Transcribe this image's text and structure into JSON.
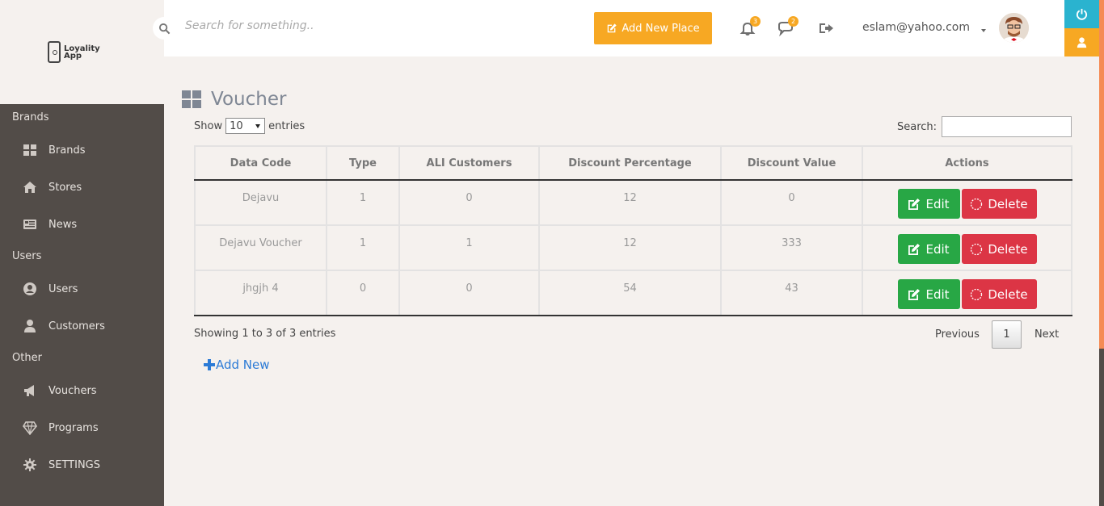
{
  "brand": {
    "logo_line1": "Loyality",
    "logo_line2": "App"
  },
  "sidebar": {
    "sections": [
      {
        "title": "Brands",
        "items": [
          {
            "label": "Brands",
            "icon": "grid-icon"
          },
          {
            "label": "Stores",
            "icon": "home-icon"
          },
          {
            "label": "News",
            "icon": "newspaper-icon"
          }
        ]
      },
      {
        "title": "Users",
        "items": [
          {
            "label": "Users",
            "icon": "user-circle-icon"
          },
          {
            "label": "Customers",
            "icon": "user-icon"
          }
        ]
      },
      {
        "title": "Other",
        "items": [
          {
            "label": "Vouchers",
            "icon": "megaphone-icon"
          },
          {
            "label": "Programs",
            "icon": "diamond-icon"
          },
          {
            "label": "SETTINGS",
            "icon": "gear-icon"
          }
        ]
      }
    ]
  },
  "topbar": {
    "search_placeholder": "Search for something..",
    "add_place_label": "Add New Place",
    "notifications_count": "3",
    "messages_count": "2",
    "user_email": "eslam@yahoo.com"
  },
  "page": {
    "title": "Voucher",
    "show_label": "Show",
    "entries_label": "entries",
    "page_size": "10",
    "search_label": "Search:",
    "columns": [
      "Data Code",
      "Type",
      "ALI Customers",
      "Discount Percentage",
      "Discount Value",
      "Actions"
    ],
    "rows": [
      {
        "code": "Dejavu",
        "type": "1",
        "customers": "0",
        "percentage": "12",
        "value": "0"
      },
      {
        "code": "Dejavu Voucher",
        "type": "1",
        "customers": "1",
        "percentage": "12",
        "value": "333"
      },
      {
        "code": "jhgjh 4",
        "type": "0",
        "customers": "0",
        "percentage": "54",
        "value": "43"
      }
    ],
    "edit_label": "Edit",
    "delete_label": "Delete",
    "showing_text": "Showing 1 to 3 of 3 entries",
    "previous_label": "Previous",
    "current_page": "1",
    "next_label": "Next",
    "add_new_label": "Add New"
  },
  "colors": {
    "accent": "#f7a823",
    "sidebar": "#524c48",
    "edit": "#28a745",
    "delete": "#dc3545",
    "link": "#2c7bd6"
  }
}
